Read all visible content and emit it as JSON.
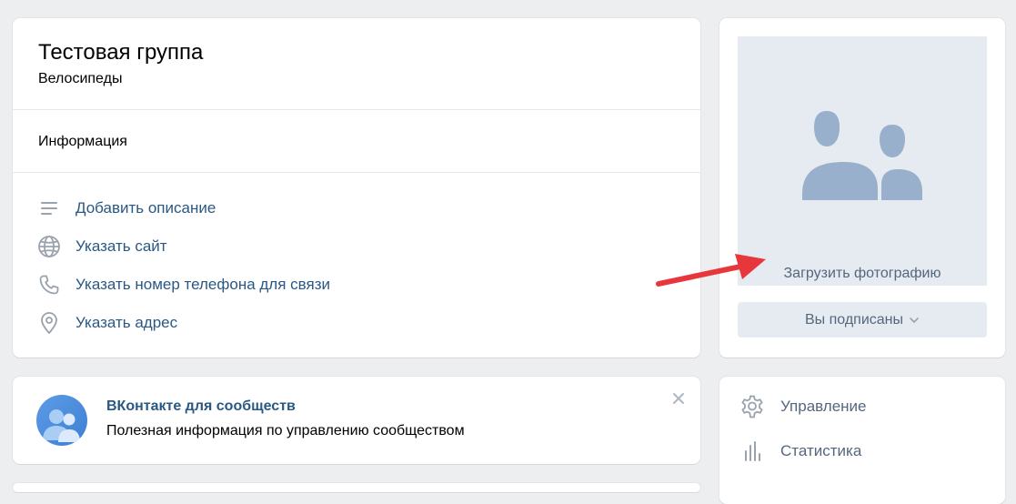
{
  "group": {
    "title": "Тестовая группа",
    "subtitle": "Велосипеды",
    "info_header": "Информация",
    "links": [
      {
        "label": "Добавить описание",
        "icon": "list-icon"
      },
      {
        "label": "Указать сайт",
        "icon": "globe-icon"
      },
      {
        "label": "Указать номер телефона для связи",
        "icon": "phone-icon"
      },
      {
        "label": "Указать адрес",
        "icon": "location-pin-icon"
      }
    ]
  },
  "banner": {
    "title": "ВКонтакте для сообществ",
    "text": "Полезная информация по управлению сообществом"
  },
  "photo": {
    "upload_label": "Загрузить фотографию",
    "subscribed_label": "Вы подписаны"
  },
  "menu": {
    "items": [
      {
        "label": "Управление",
        "icon": "gear-icon"
      },
      {
        "label": "Статистика",
        "icon": "bar-chart-icon"
      }
    ]
  },
  "colors": {
    "link": "#2a5885",
    "muted": "#55677d",
    "placeholder_bg": "#e5ebf1",
    "arrow": "#e8373c"
  }
}
